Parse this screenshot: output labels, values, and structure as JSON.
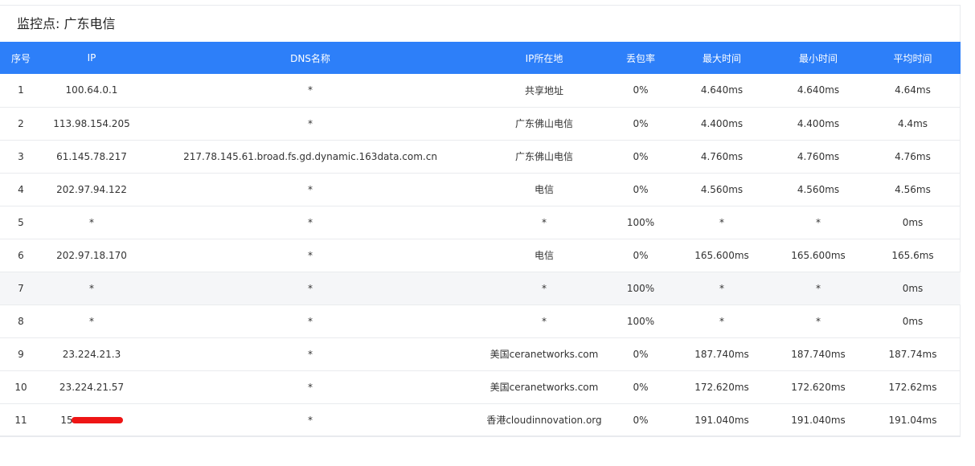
{
  "panel": {
    "title": "监控点: 广东电信"
  },
  "table": {
    "headers": {
      "index": "序号",
      "ip": "IP",
      "dns": "DNS名称",
      "location": "IP所在地",
      "loss": "丢包率",
      "max": "最大时间",
      "min": "最小时间",
      "avg": "平均时间"
    },
    "rows": [
      {
        "index": "1",
        "ip": "100.64.0.1",
        "dns": "*",
        "location": "共享地址",
        "loss": "0%",
        "max": "4.640ms",
        "min": "4.640ms",
        "avg": "4.64ms"
      },
      {
        "index": "2",
        "ip": "113.98.154.205",
        "dns": "*",
        "location": "广东佛山电信",
        "loss": "0%",
        "max": "4.400ms",
        "min": "4.400ms",
        "avg": "4.4ms"
      },
      {
        "index": "3",
        "ip": "61.145.78.217",
        "dns": "217.78.145.61.broad.fs.gd.dynamic.163data.com.cn",
        "location": "广东佛山电信",
        "loss": "0%",
        "max": "4.760ms",
        "min": "4.760ms",
        "avg": "4.76ms"
      },
      {
        "index": "4",
        "ip": "202.97.94.122",
        "dns": "*",
        "location": "电信",
        "loss": "0%",
        "max": "4.560ms",
        "min": "4.560ms",
        "avg": "4.56ms"
      },
      {
        "index": "5",
        "ip": "*",
        "dns": "*",
        "location": "*",
        "loss": "100%",
        "max": "*",
        "min": "*",
        "avg": "0ms"
      },
      {
        "index": "6",
        "ip": "202.97.18.170",
        "dns": "*",
        "location": "电信",
        "loss": "0%",
        "max": "165.600ms",
        "min": "165.600ms",
        "avg": "165.6ms"
      },
      {
        "index": "7",
        "ip": "*",
        "dns": "*",
        "location": "*",
        "loss": "100%",
        "max": "*",
        "min": "*",
        "avg": "0ms"
      },
      {
        "index": "8",
        "ip": "*",
        "dns": "*",
        "location": "*",
        "loss": "100%",
        "max": "*",
        "min": "*",
        "avg": "0ms"
      },
      {
        "index": "9",
        "ip": "23.224.21.3",
        "dns": "*",
        "location": "美国ceranetworks.com",
        "loss": "0%",
        "max": "187.740ms",
        "min": "187.740ms",
        "avg": "187.74ms"
      },
      {
        "index": "10",
        "ip": "23.224.21.57",
        "dns": "*",
        "location": "美国ceranetworks.com",
        "loss": "0%",
        "max": "172.620ms",
        "min": "172.620ms",
        "avg": "172.62ms"
      },
      {
        "index": "11",
        "ip": "15",
        "dns": "*",
        "location": "香港cloudinnovation.org",
        "loss": "0%",
        "max": "191.040ms",
        "min": "191.040ms",
        "avg": "191.04ms"
      }
    ]
  },
  "colors": {
    "header_bg": "#2d7ff9",
    "redaction": "#ee1515",
    "highlight_row": "#f5f6f8"
  }
}
